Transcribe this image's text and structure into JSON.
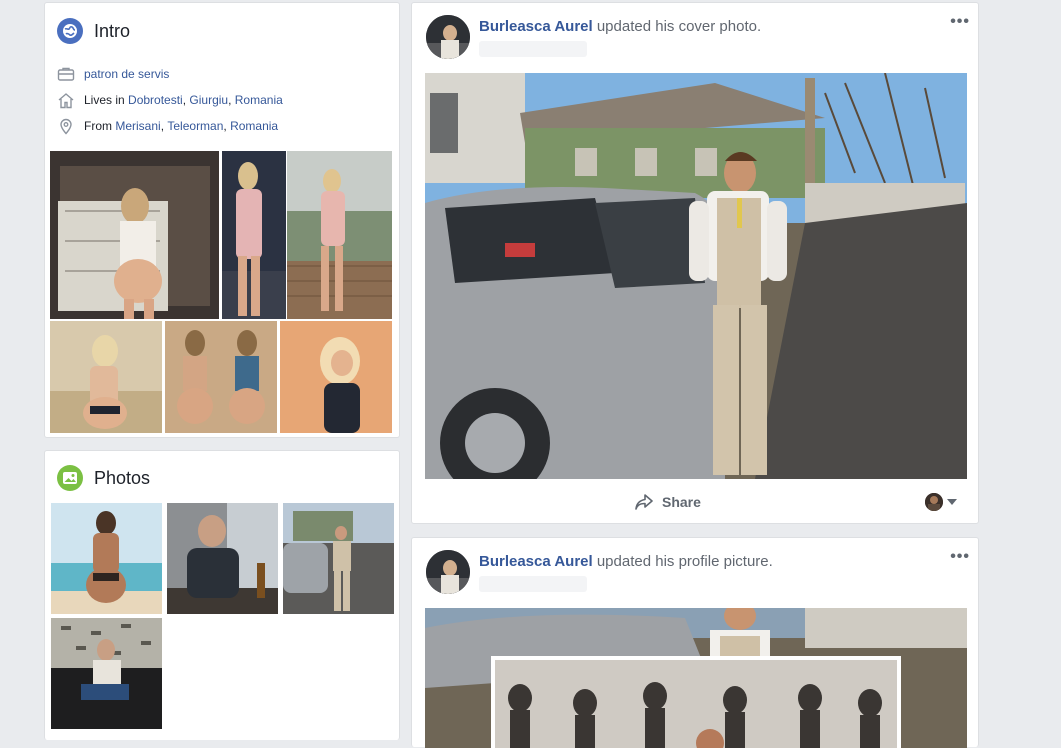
{
  "intro": {
    "title": "Intro",
    "work": "patron de servis",
    "lives_prefix": "Lives in",
    "lives_city": "Dobrotesti",
    "lives_county": "Giurgiu",
    "lives_country": "Romania",
    "from_prefix": "From",
    "from_city": "Merisani",
    "from_county": "Teleorman",
    "from_country": "Romania"
  },
  "photos": {
    "title": "Photos"
  },
  "posts": [
    {
      "author": "Burleasca Aurel",
      "action": "updated his cover photo.",
      "share_label": "Share"
    },
    {
      "author": "Burleasca Aurel",
      "action": "updated his profile picture."
    }
  ],
  "icons": {
    "intro": "globe-icon",
    "photos": "photo-icon",
    "work": "briefcase-icon",
    "lives": "home-icon",
    "from": "location-pin-icon",
    "share": "share-arrow-icon",
    "more": "more-dots-icon",
    "audience": "audience-selector-icon"
  },
  "colors": {
    "background": "#e9ebee",
    "link": "#365899",
    "intro_icon": "#4a6fbf",
    "photos_icon": "#7bc043"
  }
}
